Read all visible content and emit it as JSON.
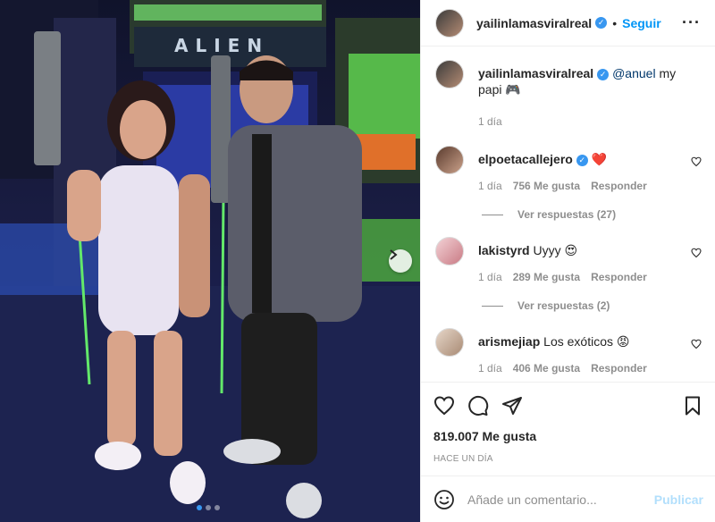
{
  "post": {
    "author": "yailinlamasviralreal",
    "verified": true,
    "separator": "•",
    "follow_label": "Seguir",
    "more_label": "···",
    "carousel": {
      "slides": 3,
      "active_index": 0
    }
  },
  "caption": {
    "user": "yailinlamasviralreal",
    "mention": "@anuel",
    "text": " my papi 🎮",
    "time": "1 día"
  },
  "comments": [
    {
      "user": "elpoetacallejero",
      "verified": true,
      "text": "❤️",
      "time": "1 día",
      "likes": "756 Me gusta",
      "reply_label": "Responder",
      "view_replies": "Ver respuestas (27)"
    },
    {
      "user": "lakistyrd",
      "verified": false,
      "text": "Uyyy 😍",
      "time": "1 día",
      "likes": "289 Me gusta",
      "reply_label": "Responder",
      "view_replies": "Ver respuestas (2)"
    },
    {
      "user": "arismejiap",
      "verified": false,
      "text": "Los exóticos 😡",
      "time": "1 día",
      "likes": "406 Me gusta",
      "reply_label": "Responder"
    }
  ],
  "footer": {
    "likes": "819.007 Me gusta",
    "time_ago": "HACE UN DÍA",
    "comment_placeholder": "Añade un comentario...",
    "publish_label": "Publicar"
  },
  "colors": {
    "link": "#0095f6",
    "verified": "#3897f0",
    "muted": "#8e8e8e",
    "publish_disabled": "#b2dffc"
  }
}
